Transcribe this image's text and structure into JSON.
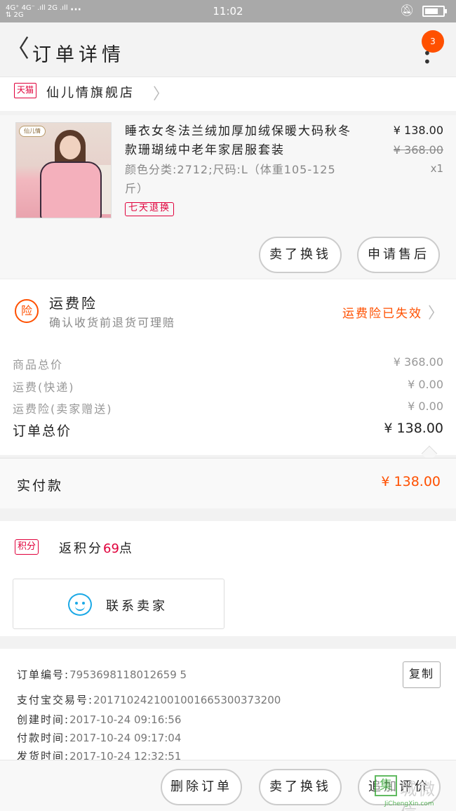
{
  "status_bar": {
    "signal": "4G⁺ 4G⁻\n2G 2G",
    "dots": "···",
    "time": "11:02",
    "bell_icon": "bell-muted-icon",
    "battery_level": 0.75
  },
  "nav": {
    "title": "订单详情",
    "back_icon": "chevron-left-icon",
    "badge_count": "3",
    "more_icon": "more-vertical-icon"
  },
  "store": {
    "platform_tag": "天猫",
    "name": "仙儿情旗舰店"
  },
  "goods": {
    "thumb_logo": "仙儿情",
    "title": "睡衣女冬法兰绒加厚加绒保暖大码秋冬款珊瑚绒中老年家居服套装",
    "sku": "颜色分类:2712;尺码:L（体重105-125斤）",
    "tag": "七天退换",
    "price": "¥ 138.00",
    "original_price": "¥ 368.00",
    "quantity": "x1",
    "actions": [
      "卖了换钱",
      "申请售后"
    ]
  },
  "insurance": {
    "icon_text": "险",
    "title": "运费险",
    "subtitle": "确认收货前退货可理赔",
    "status": "运费险已失效"
  },
  "fees": {
    "rows": [
      {
        "label": "商品总价",
        "value": "¥ 368.00"
      },
      {
        "label": "运费(快递)",
        "value": "¥ 0.00"
      },
      {
        "label": "运费险(卖家赠送)",
        "value": "¥ 0.00"
      }
    ],
    "total_label": "订单总价",
    "total_value": "¥ 138.00"
  },
  "paid": {
    "label": "实付款",
    "value": "¥ 138.00"
  },
  "points": {
    "tag": "积分",
    "text_prefix": "返积分",
    "value": "69",
    "text_suffix": "点"
  },
  "contact": {
    "label": "联系卖家"
  },
  "order_info": {
    "copy_label": "复制",
    "rows": [
      {
        "label": "订单编号:",
        "value": "7953698118012659 5"
      },
      {
        "label": "支付宝交易号:",
        "value": "2017102421001001665300373200"
      },
      {
        "label": "创建时间:",
        "value": "2017-10-24 09:16:56"
      },
      {
        "label": "付款时间:",
        "value": "2017-10-24 09:17:04"
      },
      {
        "label": "发货时间:",
        "value": "2017-10-24 12:32:51"
      }
    ]
  },
  "bottom_actions": [
    "删除订单",
    "卖了换钱",
    "追加评价"
  ],
  "watermark": {
    "box": "集",
    "chars": "城微信",
    "url": "JiChengXin.com"
  },
  "colors": {
    "accent": "#ff5000",
    "tmall_red": "#e0003b",
    "contact_blue": "#1ca9e6"
  }
}
